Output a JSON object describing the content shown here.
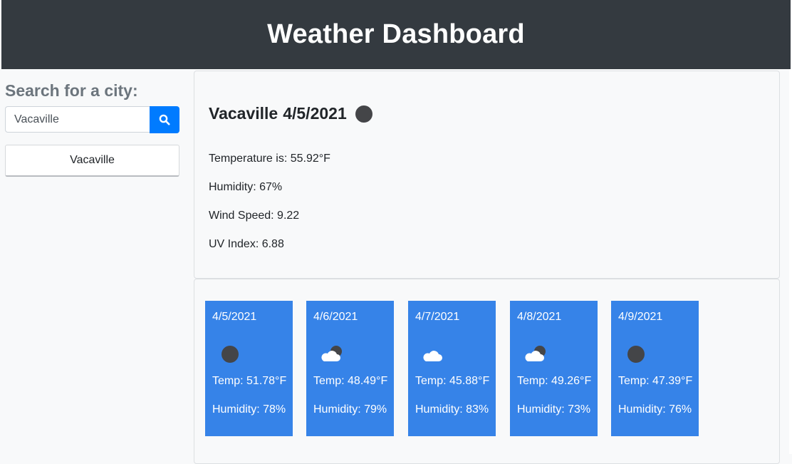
{
  "header": {
    "title": "Weather Dashboard"
  },
  "sidebar": {
    "search_title": "Search for a city:",
    "search_value": "Vacaville",
    "search_icon": "search-icon",
    "history": [
      "Vacaville"
    ]
  },
  "current": {
    "city": "Vacaville",
    "date": "4/5/2021",
    "icon": "moon-icon",
    "temperature": "Temperature is: 55.92°F",
    "humidity": "Humidity: 67%",
    "wind": "Wind Speed: 9.22",
    "uv": "UV Index: 6.88"
  },
  "forecast": [
    {
      "date": "4/5/2021",
      "icon": "moon-icon",
      "temp": "Temp: 51.78°F",
      "humidity": "Humidity: 78%"
    },
    {
      "date": "4/6/2021",
      "icon": "cloud-moon-icon",
      "temp": "Temp: 48.49°F",
      "humidity": "Humidity: 79%"
    },
    {
      "date": "4/7/2021",
      "icon": "cloud-icon",
      "temp": "Temp: 45.88°F",
      "humidity": "Humidity: 83%"
    },
    {
      "date": "4/8/2021",
      "icon": "cloud-moon-icon",
      "temp": "Temp: 49.26°F",
      "humidity": "Humidity: 73%"
    },
    {
      "date": "4/9/2021",
      "icon": "moon-icon",
      "temp": "Temp: 47.39°F",
      "humidity": "Humidity: 76%"
    }
  ],
  "colors": {
    "header_bg": "#343a40",
    "accent": "#007bff",
    "forecast_card": "#3683e8",
    "moon": "#444548"
  }
}
